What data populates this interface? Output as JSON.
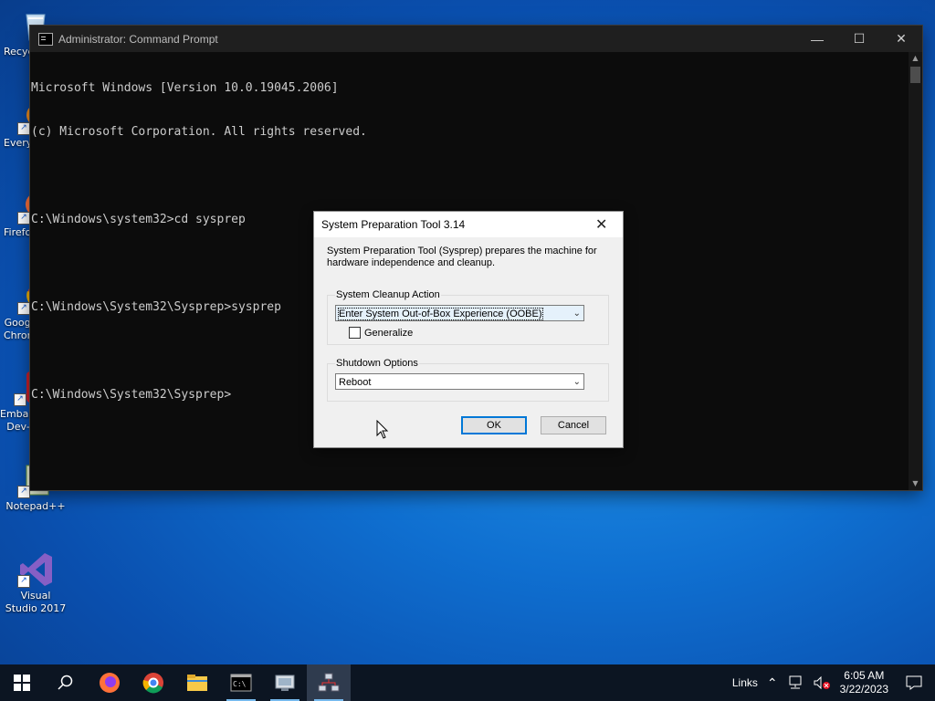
{
  "desktop": {
    "icons": [
      {
        "label": "Recycle Bin"
      },
      {
        "label": "Everything"
      },
      {
        "label": "Firefox"
      },
      {
        "label": "Google Chrome"
      },
      {
        "label": "Embarcadero Dev-C++"
      },
      {
        "label": "Notepad++"
      },
      {
        "label": "Visual Studio 2017"
      }
    ]
  },
  "cmd": {
    "title": "Administrator: Command Prompt",
    "lines": [
      "Microsoft Windows [Version 10.0.19045.2006]",
      "(c) Microsoft Corporation. All rights reserved.",
      "",
      "C:\\Windows\\system32>cd sysprep",
      "",
      "C:\\Windows\\System32\\Sysprep>sysprep",
      "",
      "C:\\Windows\\System32\\Sysprep>"
    ]
  },
  "dialog": {
    "title": "System Preparation Tool 3.14",
    "description": "System Preparation Tool (Sysprep) prepares the machine for hardware independence and cleanup.",
    "cleanup": {
      "legend": "System Cleanup Action",
      "selected": "Enter System Out-of-Box Experience (OOBE)",
      "generalize_label": "Generalize",
      "generalize_checked": false
    },
    "shutdown": {
      "legend": "Shutdown Options",
      "selected": "Reboot"
    },
    "ok_label": "OK",
    "cancel_label": "Cancel"
  },
  "taskbar": {
    "links_label": "Links",
    "time": "6:05 AM",
    "date": "3/22/2023"
  }
}
